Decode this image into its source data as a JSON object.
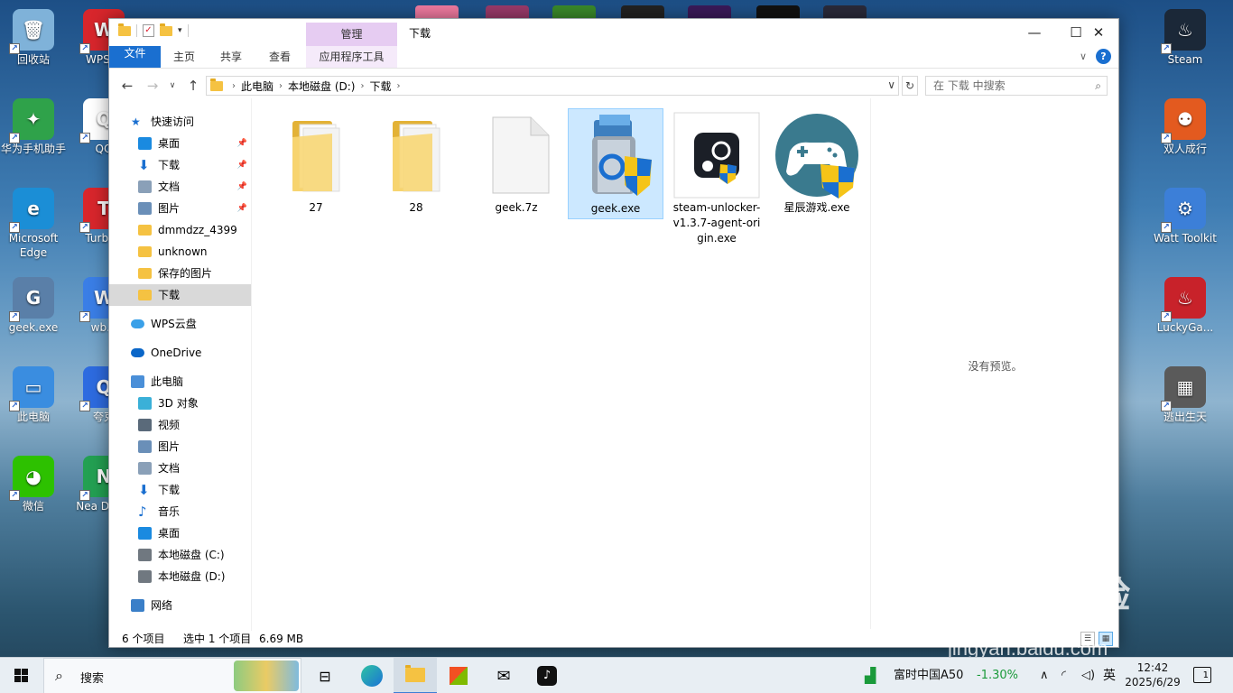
{
  "desktop": {
    "left_icons": [
      {
        "label": "回收站",
        "color": "#7fb2d9",
        "glyph": "🗑"
      },
      {
        "label": "华为手机助手",
        "color": "#2fa24a",
        "glyph": "✦"
      },
      {
        "label": "Microsoft Edge",
        "color": "#1b8ed6",
        "glyph": "e"
      },
      {
        "label": "geek.exe",
        "color": "#5a7fa8",
        "glyph": "G"
      },
      {
        "label": "此电脑",
        "color": "#3a8de0",
        "glyph": "▭"
      },
      {
        "label": "微信",
        "color": "#2dc100",
        "glyph": "◕"
      }
    ],
    "second_col_icons": [
      {
        "label": "WPS O",
        "color": "#d8262c",
        "glyph": "W"
      },
      {
        "label": "QQ",
        "color": "#ffffff",
        "glyph": "Q"
      },
      {
        "label": "TurboV",
        "color": "#d8262c",
        "glyph": "T"
      },
      {
        "label": "wb.e",
        "color": "#3a7ee6",
        "glyph": "W"
      },
      {
        "label": "夸克",
        "color": "#2d6be0",
        "glyph": "Q"
      },
      {
        "label": "Nea Down",
        "color": "#23a052",
        "glyph": "N"
      }
    ],
    "right_icons": [
      {
        "label": "Steam",
        "color": "#1b2838",
        "glyph": "♨"
      },
      {
        "label": "双人成行",
        "color": "#e35a1f",
        "glyph": "⚉"
      },
      {
        "label": "Watt Toolkit",
        "color": "#3c7fd8",
        "glyph": "⚙"
      },
      {
        "label": "LuckyGa...",
        "color": "#c8222a",
        "glyph": "♨"
      },
      {
        "label": "逃出生天",
        "color": "#5a5a5a",
        "glyph": "▦"
      }
    ]
  },
  "window": {
    "title": "下载",
    "manage_tab": "管理",
    "ribbon_tabs": [
      "文件",
      "主页",
      "共享",
      "查看",
      "应用程序工具"
    ],
    "address": [
      "此电脑",
      "本地磁盘 (D:)",
      "下载"
    ],
    "search_placeholder": "在 下载 中搜索",
    "sidebar": [
      {
        "label": "快速访问",
        "icon": "star-icon",
        "color": "#1a6fd0",
        "level": 0
      },
      {
        "label": "桌面",
        "icon": "desktop-icon",
        "color": "#1a8ae0",
        "level": 1,
        "pinned": true
      },
      {
        "label": "下载",
        "icon": "download-icon",
        "color": "#1a6fd0",
        "level": 1,
        "pinned": true
      },
      {
        "label": "文档",
        "icon": "document-icon",
        "color": "#8aa0b8",
        "level": 1,
        "pinned": true
      },
      {
        "label": "图片",
        "icon": "picture-icon",
        "color": "#6a8fb8",
        "level": 1,
        "pinned": true
      },
      {
        "label": "dmmdzz_4399",
        "icon": "folder-icon",
        "color": "#f5c242",
        "level": 1
      },
      {
        "label": "unknown",
        "icon": "folder-icon",
        "color": "#f5c242",
        "level": 1
      },
      {
        "label": "保存的图片",
        "icon": "folder-icon",
        "color": "#f5c242",
        "level": 1
      },
      {
        "label": "下载",
        "icon": "folder-icon",
        "color": "#f5c242",
        "level": 1,
        "selected": true
      },
      {
        "label": "WPS云盘",
        "icon": "cloud-icon",
        "color": "#3aa0e8",
        "level": 0
      },
      {
        "label": "OneDrive",
        "icon": "cloud-icon",
        "color": "#0a66c8",
        "level": 0
      },
      {
        "label": "此电脑",
        "icon": "computer-icon",
        "color": "#4a8fd8",
        "level": 0
      },
      {
        "label": "3D 对象",
        "icon": "cube-icon",
        "color": "#3ab0d8",
        "level": 1
      },
      {
        "label": "视频",
        "icon": "video-icon",
        "color": "#5a6a7a",
        "level": 1
      },
      {
        "label": "图片",
        "icon": "picture-icon",
        "color": "#6a8fb8",
        "level": 1
      },
      {
        "label": "文档",
        "icon": "document-icon",
        "color": "#8aa0b8",
        "level": 1
      },
      {
        "label": "下载",
        "icon": "download-icon",
        "color": "#1a6fd0",
        "level": 1
      },
      {
        "label": "音乐",
        "icon": "music-icon",
        "color": "#1a6fd0",
        "level": 1
      },
      {
        "label": "桌面",
        "icon": "desktop-icon",
        "color": "#1a8ae0",
        "level": 1
      },
      {
        "label": "本地磁盘 (C:)",
        "icon": "drive-icon",
        "color": "#707880",
        "level": 1
      },
      {
        "label": "本地磁盘 (D:)",
        "icon": "drive-icon",
        "color": "#707880",
        "level": 1
      },
      {
        "label": "网络",
        "icon": "network-icon",
        "color": "#3a7fc8",
        "level": 0
      }
    ],
    "files": [
      {
        "name": "27",
        "type": "folder"
      },
      {
        "name": "28",
        "type": "folder"
      },
      {
        "name": "geek.7z",
        "type": "blank"
      },
      {
        "name": "geek.exe",
        "type": "geek",
        "selected": true
      },
      {
        "name": "steam-unlocker-v1.3.7-agent-origin.exe",
        "type": "steam"
      },
      {
        "name": "星辰游戏.exe",
        "type": "gamepad"
      }
    ],
    "preview_text": "没有预览。",
    "status": {
      "count": "6 个项目",
      "selection": "选中 1 个项目",
      "size": "6.69 MB"
    }
  },
  "taskbar": {
    "search_text": "搜索",
    "stock_name": "富时中国A50",
    "stock_change": "-1.30%",
    "ime": "英",
    "time": "12:42",
    "date": "2025/6/29",
    "notification_count": "1"
  },
  "watermark": "Baidu经验 jingyan.baidu.com"
}
